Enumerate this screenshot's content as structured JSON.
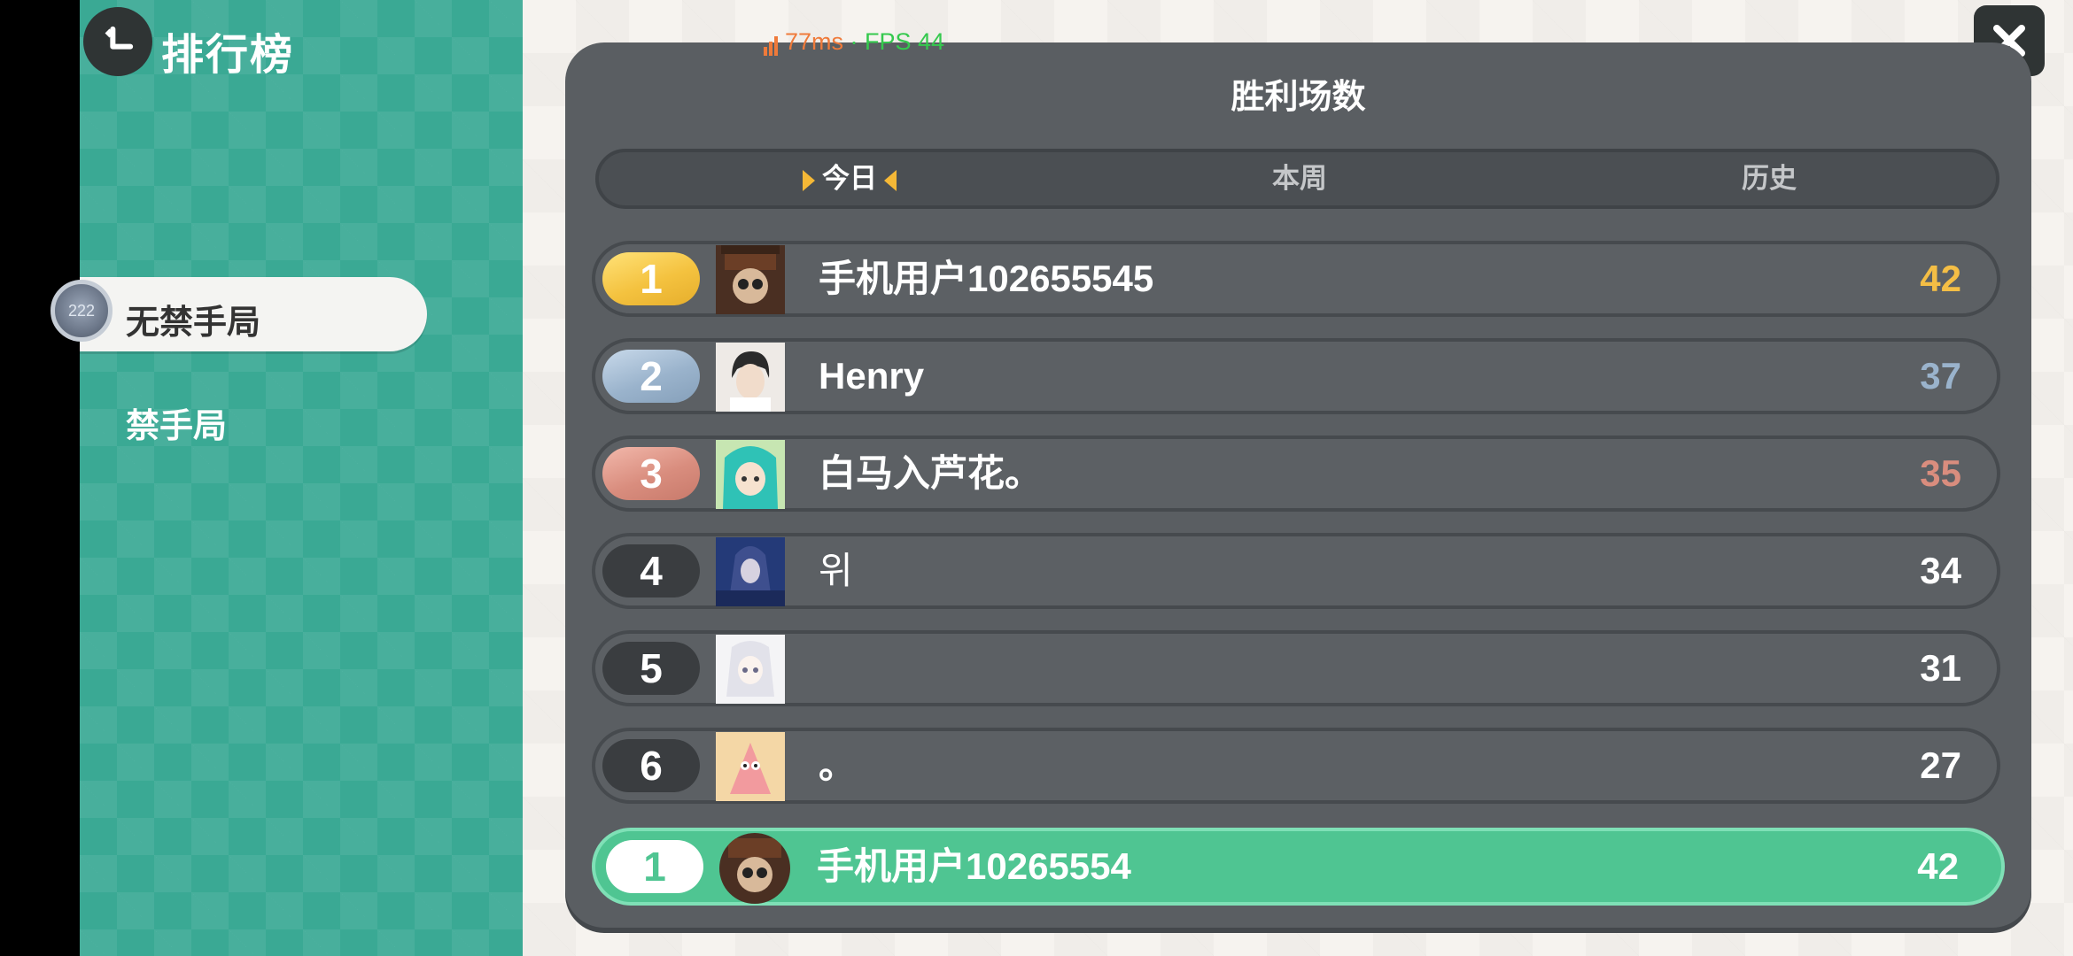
{
  "header": {
    "title": "排行榜"
  },
  "perf": {
    "latency": "77ms",
    "separator": " · ",
    "fps": "FPS 44"
  },
  "sidebar": {
    "avatar_text": "222",
    "items": [
      {
        "label": "无禁手局",
        "active": true
      },
      {
        "label": "禁手局",
        "active": false
      }
    ]
  },
  "panel": {
    "title": "胜利场数",
    "tabs": [
      {
        "label": "今日",
        "active": true
      },
      {
        "label": "本周",
        "active": false
      },
      {
        "label": "历史",
        "active": false
      }
    ]
  },
  "leaderboard": [
    {
      "rank": "1",
      "name": "手机用户102655545",
      "score": "42",
      "medal": "gold"
    },
    {
      "rank": "2",
      "name": "Henry",
      "score": "37",
      "medal": "silver"
    },
    {
      "rank": "3",
      "name": "白马入芦花。",
      "score": "35",
      "medal": "bronze"
    },
    {
      "rank": "4",
      "name": "위",
      "score": "34",
      "medal": "none"
    },
    {
      "rank": "5",
      "name": "",
      "score": "31",
      "medal": "none"
    },
    {
      "rank": "6",
      "name": "。",
      "score": "27",
      "medal": "none"
    }
  ],
  "my_entry": {
    "rank": "1",
    "name": "手机用户10265554",
    "score": "42"
  },
  "colors": {
    "sidebar": "#3aa994",
    "panel": "#5a5e62",
    "gold": "#f4be45",
    "silver": "#9ab3cc",
    "bronze": "#d98d7e",
    "my_row": "#4fc592"
  }
}
